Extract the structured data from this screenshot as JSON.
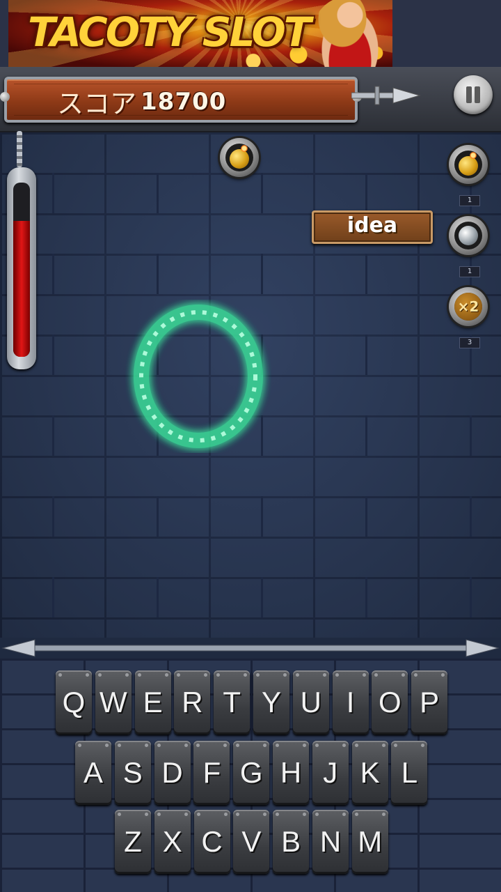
{
  "ad": {
    "title": "TACOTY SLOT"
  },
  "header": {
    "score_label": "スコア",
    "score_value": "18700"
  },
  "gauge": {
    "level": 0.78
  },
  "powerups": [
    {
      "icon": "bomb-gold-icon",
      "count": "1"
    },
    {
      "icon": "bomb-silver-icon",
      "count": "1"
    },
    {
      "icon": "multiplier-x2-icon",
      "label": "×2",
      "count": "3"
    }
  ],
  "hint": {
    "text": "idea"
  },
  "keyboard": {
    "row1": [
      "Q",
      "W",
      "E",
      "R",
      "T",
      "Y",
      "U",
      "I",
      "O",
      "P"
    ],
    "row2": [
      "A",
      "S",
      "D",
      "F",
      "G",
      "H",
      "J",
      "K",
      "L"
    ],
    "row3": [
      "Z",
      "X",
      "C",
      "V",
      "B",
      "N",
      "M"
    ]
  },
  "colors": {
    "gauge_fill": "#e01616",
    "ring_glow": "#5dffb8",
    "wood": "#8e3a17"
  }
}
